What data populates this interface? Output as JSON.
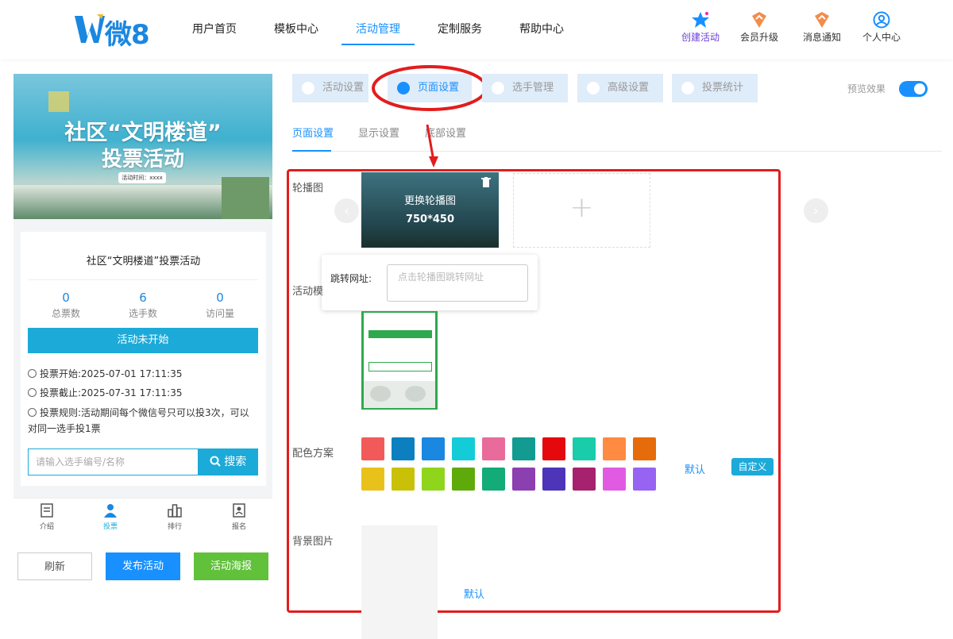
{
  "brand": {
    "logo_text": "微8"
  },
  "nav": [
    {
      "label": "用户首页"
    },
    {
      "label": "模板中心"
    },
    {
      "label": "活动管理"
    },
    {
      "label": "定制服务"
    },
    {
      "label": "帮助中心"
    }
  ],
  "tools": [
    {
      "label": "创建活动",
      "icon": "star-icon"
    },
    {
      "label": "会员升级",
      "icon": "shield-up-icon"
    },
    {
      "label": "消息通知",
      "icon": "bell-badge-icon"
    },
    {
      "label": "个人中心",
      "icon": "user-circle-icon"
    }
  ],
  "preview": {
    "banner_title_1": "社区“文明楼道”",
    "banner_title_2": "投票活动",
    "banner_time": "活动时间：xxxx",
    "title": "社区“文明楼道”投票活动",
    "stats": [
      {
        "value": "0",
        "label": "总票数"
      },
      {
        "value": "6",
        "label": "选手数"
      },
      {
        "value": "0",
        "label": "访问量"
      }
    ],
    "status_button": "活动未开始",
    "rules": [
      {
        "label": "投票开始:",
        "value": "2025-07-01 17:11:35"
      },
      {
        "label": "投票截止:",
        "value": "2025-07-31 17:11:35"
      },
      {
        "label": "投票规则:",
        "value": "活动期间每个微信号只可以投3次，可以对同一选手投1票"
      }
    ],
    "search_placeholder": "请输入选手编号/名称",
    "search_button": "搜索",
    "tabbar": [
      {
        "label": "介绍"
      },
      {
        "label": "投票"
      },
      {
        "label": "排行"
      },
      {
        "label": "报名"
      }
    ],
    "actions": [
      {
        "label": "刷新"
      },
      {
        "label": "发布活动"
      },
      {
        "label": "活动海报"
      }
    ]
  },
  "settings": {
    "tabs": [
      {
        "label": "活动设置"
      },
      {
        "label": "页面设置"
      },
      {
        "label": "选手管理"
      },
      {
        "label": "高级设置"
      },
      {
        "label": "投票统计"
      }
    ],
    "preview_label": "预览效果",
    "preview_on": true,
    "subtabs": [
      {
        "label": "页面设置"
      },
      {
        "label": "显示设置"
      },
      {
        "label": "底部设置"
      }
    ],
    "carousel_label": "轮播图",
    "carousel_overlay_1": "更换轮播图",
    "carousel_overlay_2": "750*450",
    "jump_label": "跳转网址:",
    "jump_placeholder": "点击轮播图跳转网址",
    "template_label": "活动模",
    "color_label": "配色方案",
    "colors": [
      "#f25a5a",
      "#0b7fc0",
      "#1a87e0",
      "#14ccd8",
      "#e86b9c",
      "#119b91",
      "#e5080c",
      "#19ccaa",
      "#ff8a41",
      "#e66b0a",
      "#e8c21a",
      "#c8c108",
      "#8fd51c",
      "#5faa0b",
      "#13ab78",
      "#8c3fb0",
      "#4d34b8",
      "#a7226e",
      "#e15be2",
      "#9763f2"
    ],
    "default_label": "默认",
    "custom_label": "自定义",
    "bg_label": "背景图片",
    "bg_default": "默认"
  }
}
